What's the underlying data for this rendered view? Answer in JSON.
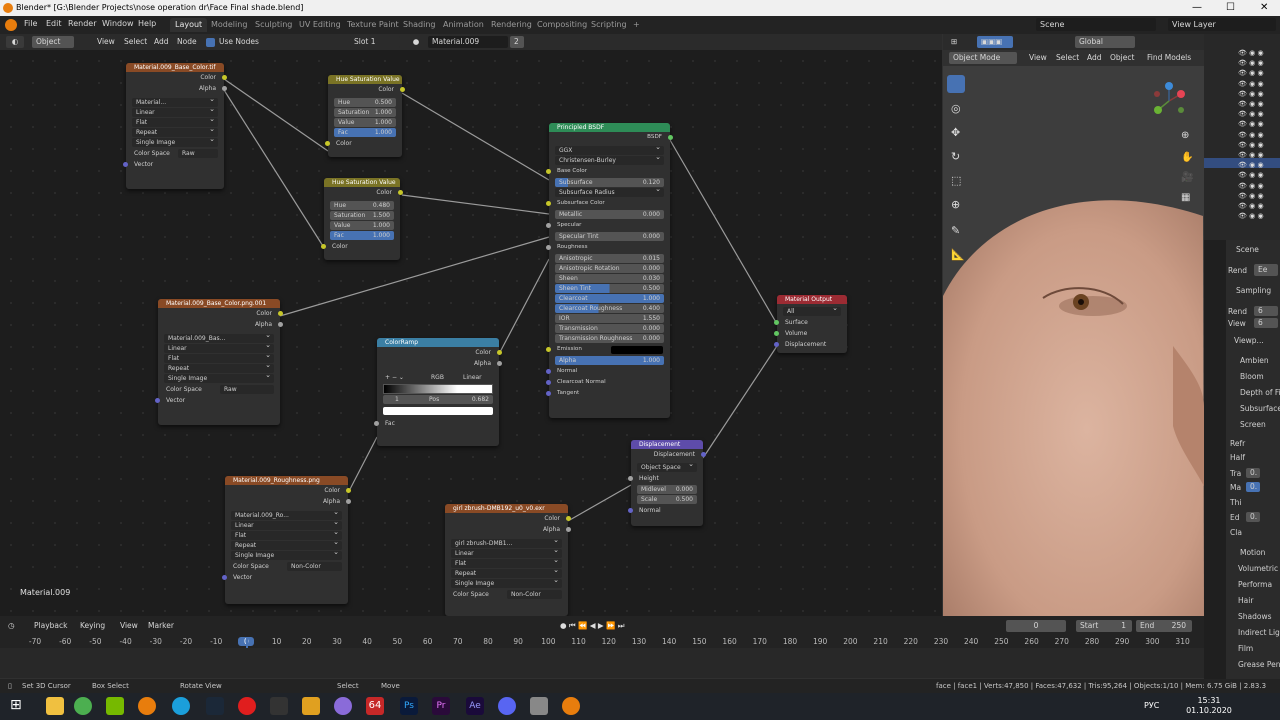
{
  "window": {
    "title": "Blender* [G:\\Blender Projects\\nose operation dr\\Face Final shade.blend]",
    "min": "—",
    "max": "☐",
    "close": "✕"
  },
  "menu": {
    "items": [
      "File",
      "Edit",
      "Render",
      "Window",
      "Help"
    ],
    "workspaces": [
      "Layout",
      "Modeling",
      "Sculpting",
      "UV Editing",
      "Texture Paint",
      "Shading",
      "Animation",
      "Rendering",
      "Compositing",
      "Scripting"
    ],
    "add_tab": "+",
    "scene": "Scene",
    "view_layer": "View Layer"
  },
  "node_header": {
    "object": "Object",
    "view": "View",
    "select": "Select",
    "add": "Add",
    "node": "Node",
    "use_nodes": "Use Nodes",
    "slot": "Slot 1",
    "material": "Material.009",
    "users": "2"
  },
  "viewport_header": {
    "mode": "Object Mode",
    "view": "View",
    "select": "Select",
    "add": "Add",
    "object": "Object",
    "transform": "Global",
    "find": "Find Models"
  },
  "nodes": {
    "tex1": {
      "title": "Material.009_Base_Color.tif",
      "out1": "Color",
      "out2": "Alpha",
      "image": "Material...",
      "interp": "Linear",
      "proj": "Flat",
      "ext": "Repeat",
      "source": "Single Image",
      "cs_label": "Color Space",
      "cs": "Raw",
      "vector": "Vector"
    },
    "hsv1": {
      "title": "Hue Saturation Value",
      "out": "Color",
      "hue_l": "Hue",
      "hue": "0.500",
      "sat_l": "Saturation",
      "sat": "1.000",
      "val_l": "Value",
      "val": "1.000",
      "fac_l": "Fac",
      "fac": "1.000",
      "color": "Color"
    },
    "hsv2": {
      "title": "Hue Saturation Value",
      "out": "Color",
      "hue_l": "Hue",
      "hue": "0.480",
      "sat_l": "Saturation",
      "sat": "1.500",
      "val_l": "Value",
      "val": "1.000",
      "fac_l": "Fac",
      "fac": "1.000",
      "color": "Color"
    },
    "bsdf": {
      "title": "Principled BSDF",
      "out": "BSDF",
      "dist": "GGX",
      "sss": "Christensen-Burley",
      "base": "Base Color",
      "subsurface_l": "Subsurface",
      "subsurface": "0.120",
      "ss_radius": "Subsurface Radius",
      "ss_color": "Subsurface Color",
      "metallic_l": "Metallic",
      "metallic": "0.000",
      "specular": "Specular",
      "spec_tint_l": "Specular Tint",
      "spec_tint": "0.000",
      "roughness": "Roughness",
      "aniso_l": "Anisotropic",
      "aniso": "0.015",
      "aniso_rot_l": "Anisotropic Rotation",
      "aniso_rot": "0.000",
      "sheen_l": "Sheen",
      "sheen": "0.030",
      "sheen_tint_l": "Sheen Tint",
      "sheen_tint": "0.500",
      "cc_l": "Clearcoat",
      "cc": "1.000",
      "ccr_l": "Clearcoat Roughness",
      "ccr": "0.400",
      "ior_l": "IOR",
      "ior": "1.550",
      "trans_l": "Transmission",
      "trans": "0.000",
      "tr_rough_l": "Transmission Roughness",
      "tr_rough": "0.000",
      "emission": "Emission",
      "alpha_l": "Alpha",
      "alpha": "1.000",
      "normal": "Normal",
      "cc_normal": "Clearcoat Normal",
      "tangent": "Tangent"
    },
    "out": {
      "title": "Material Output",
      "target": "All",
      "surface": "Surface",
      "volume": "Volume",
      "disp": "Displacement"
    },
    "tex2": {
      "title": "Material.009_Base_Color.png.001",
      "out1": "Color",
      "out2": "Alpha",
      "image": "Material.009_Bas...",
      "interp": "Linear",
      "proj": "Flat",
      "ext": "Repeat",
      "source": "Single Image",
      "cs_label": "Color Space",
      "cs": "Raw",
      "vector": "Vector"
    },
    "ramp": {
      "title": "ColorRamp",
      "out1": "Color",
      "out2": "Alpha",
      "mode": "RGB",
      "interp": "Linear",
      "index": "1",
      "pos_l": "Pos",
      "pos": "0.682",
      "fac": "Fac"
    },
    "tex3": {
      "title": "Material.009_Roughness.png",
      "out1": "Color",
      "out2": "Alpha",
      "image": "Material.009_Ro...",
      "interp": "Linear",
      "proj": "Flat",
      "ext": "Repeat",
      "source": "Single Image",
      "cs_label": "Color Space",
      "cs": "Non-Color",
      "vector": "Vector"
    },
    "disp": {
      "title": "Displacement",
      "out": "Displacement",
      "space": "Object Space",
      "height": "Height",
      "mid_l": "Midlevel",
      "mid": "0.000",
      "scale_l": "Scale",
      "scale": "0.500",
      "normal": "Normal"
    },
    "tex4": {
      "title": "girl zbrush-DMB192_u0_v0.exr",
      "out1": "Color",
      "out2": "Alpha",
      "image": "girl zbrush-DMB1...",
      "interp": "Linear",
      "proj": "Flat",
      "ext": "Repeat",
      "source": "Single Image",
      "cs_label": "Color Space",
      "cs": "Non-Color"
    }
  },
  "editor_label": "Material.009",
  "timeline": {
    "playback": "Playback",
    "keying": "Keying",
    "view": "View",
    "marker": "Marker",
    "current": "0",
    "start_l": "Start",
    "start": "1",
    "end_l": "End",
    "end": "250",
    "ticks": [
      "-70",
      "-60",
      "-50",
      "-40",
      "-30",
      "-20",
      "-10",
      "0",
      "10",
      "20",
      "30",
      "40",
      "50",
      "60",
      "70",
      "80",
      "90",
      "100",
      "110",
      "120",
      "130",
      "140",
      "150",
      "160",
      "170",
      "180",
      "190",
      "200",
      "210",
      "220",
      "230",
      "240",
      "250",
      "260",
      "270",
      "280",
      "290",
      "300",
      "310"
    ]
  },
  "status": {
    "a": "Set 3D Cursor",
    "b": "Box Select",
    "c": "Rotate View",
    "d": "Select",
    "e": "Move",
    "stats": "face | face1 | Verts:47,850 | Faces:47,632 | Tris:95,264 | Objects:1/10 | Mem: 6.75 GiB | 2.83.3"
  },
  "properties": {
    "scene": "Scene",
    "render_l": "Rend",
    "engine": "Ee",
    "sampling": "Sampling",
    "render_samples_l": "Rend",
    "render_samples": "6",
    "viewport_samples_l": "View",
    "viewport_samples": "6",
    "viewport_denoise": "Viewp...",
    "items": [
      "Ambien",
      "Bloom",
      "Depth of Fi",
      "Subsurface",
      "Screen"
    ],
    "refr": "Refr",
    "half": "Half",
    "tra": "Tra",
    "tra_v": "0.",
    "ma": "Ma",
    "ma_v": "0.",
    "thi": "Thi",
    "ed": "Ed",
    "ed_v": "0.",
    "cla": "Cla",
    "items2": [
      "Motion",
      "Volumetric",
      "Performa",
      "Hair",
      "Shadows",
      "Indirect Lig",
      "Film",
      "Grease Pen"
    ]
  },
  "taskbar": {
    "lang": "РУС",
    "time": "15:31",
    "date": "01.10.2020"
  }
}
